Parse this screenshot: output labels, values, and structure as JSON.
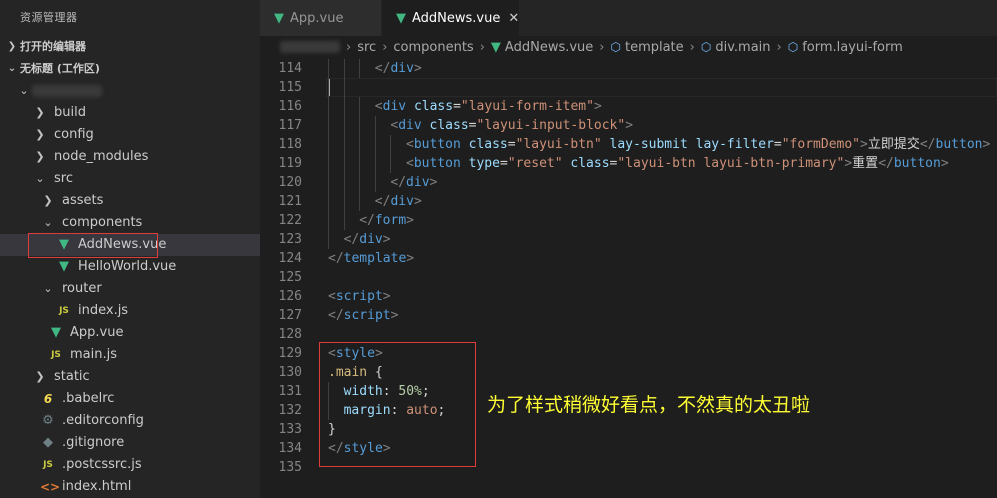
{
  "sidebar": {
    "title": "资源管理器",
    "open_editors": "打开的编辑器",
    "workspace": "无标题 (工作区)",
    "tree": [
      {
        "label": "build",
        "icon": "chevron-right",
        "indent": 1,
        "kind": "folder"
      },
      {
        "label": "config",
        "icon": "chevron-right",
        "indent": 1,
        "kind": "folder"
      },
      {
        "label": "node_modules",
        "icon": "chevron-right",
        "indent": 1,
        "kind": "folder"
      },
      {
        "label": "src",
        "icon": "chevron-down",
        "indent": 1,
        "kind": "folder"
      },
      {
        "label": "assets",
        "icon": "chevron-right",
        "indent": 2,
        "kind": "folder"
      },
      {
        "label": "components",
        "icon": "chevron-down",
        "indent": 2,
        "kind": "folder"
      },
      {
        "label": "AddNews.vue",
        "icon": "vue",
        "indent": 3,
        "kind": "file",
        "selected": true
      },
      {
        "label": "HelloWorld.vue",
        "icon": "vue",
        "indent": 3,
        "kind": "file"
      },
      {
        "label": "router",
        "icon": "chevron-down",
        "indent": 2,
        "kind": "folder"
      },
      {
        "label": "index.js",
        "icon": "js",
        "indent": 3,
        "kind": "file"
      },
      {
        "label": "App.vue",
        "icon": "vue",
        "indent": 2,
        "kind": "file"
      },
      {
        "label": "main.js",
        "icon": "js",
        "indent": 2,
        "kind": "file"
      },
      {
        "label": "static",
        "icon": "chevron-right",
        "indent": 1,
        "kind": "folder"
      },
      {
        "label": ".babelrc",
        "icon": "babel",
        "indent": 1,
        "kind": "file"
      },
      {
        "label": ".editorconfig",
        "icon": "gear",
        "indent": 1,
        "kind": "file"
      },
      {
        "label": ".gitignore",
        "icon": "git",
        "indent": 1,
        "kind": "file"
      },
      {
        "label": ".postcssrc.js",
        "icon": "js",
        "indent": 1,
        "kind": "file"
      },
      {
        "label": "index.html",
        "icon": "html",
        "indent": 1,
        "kind": "file"
      }
    ]
  },
  "tabs": [
    {
      "label": "App.vue",
      "active": false
    },
    {
      "label": "AddNews.vue",
      "active": true
    }
  ],
  "breadcrumb": [
    "src",
    "components",
    "AddNews.vue",
    "template",
    "div.main",
    "form.layui-form"
  ],
  "editor": {
    "current_line": 115,
    "lines": [
      {
        "n": "114",
        "i": 3,
        "c": [
          [
            "t",
            "</"
          ],
          [
            "tn",
            "div"
          ],
          [
            "t",
            ">"
          ]
        ]
      },
      {
        "n": "115",
        "i": 2,
        "c": []
      },
      {
        "n": "116",
        "i": 3,
        "c": [
          [
            "t",
            "<"
          ],
          [
            "tn",
            "div"
          ],
          [
            "tx",
            " "
          ],
          [
            "an",
            "class"
          ],
          [
            "tx",
            "="
          ],
          [
            "av",
            "\"layui-form-item\""
          ],
          [
            "t",
            ">"
          ]
        ]
      },
      {
        "n": "117",
        "i": 4,
        "c": [
          [
            "t",
            "<"
          ],
          [
            "tn",
            "div"
          ],
          [
            "tx",
            " "
          ],
          [
            "an",
            "class"
          ],
          [
            "tx",
            "="
          ],
          [
            "av",
            "\"layui-input-block\""
          ],
          [
            "t",
            ">"
          ]
        ]
      },
      {
        "n": "118",
        "i": 5,
        "c": [
          [
            "t",
            "<"
          ],
          [
            "tn",
            "button"
          ],
          [
            "tx",
            " "
          ],
          [
            "an",
            "class"
          ],
          [
            "tx",
            "="
          ],
          [
            "av",
            "\"layui-btn\""
          ],
          [
            "tx",
            " "
          ],
          [
            "an",
            "lay-submit"
          ],
          [
            "tx",
            " "
          ],
          [
            "an",
            "lay-filter"
          ],
          [
            "tx",
            "="
          ],
          [
            "av",
            "\"formDemo\""
          ],
          [
            "t",
            ">"
          ],
          [
            "tx",
            "立即提交"
          ],
          [
            "t",
            "</"
          ],
          [
            "tn",
            "button"
          ],
          [
            "t",
            ">"
          ]
        ]
      },
      {
        "n": "119",
        "i": 5,
        "c": [
          [
            "t",
            "<"
          ],
          [
            "tn",
            "button"
          ],
          [
            "tx",
            " "
          ],
          [
            "an",
            "type"
          ],
          [
            "tx",
            "="
          ],
          [
            "av",
            "\"reset\""
          ],
          [
            "tx",
            " "
          ],
          [
            "an",
            "class"
          ],
          [
            "tx",
            "="
          ],
          [
            "av",
            "\"layui-btn layui-btn-primary\""
          ],
          [
            "t",
            ">"
          ],
          [
            "tx",
            "重置"
          ],
          [
            "t",
            "</"
          ],
          [
            "tn",
            "button"
          ],
          [
            "t",
            ">"
          ]
        ]
      },
      {
        "n": "120",
        "i": 4,
        "c": [
          [
            "t",
            "</"
          ],
          [
            "tn",
            "div"
          ],
          [
            "t",
            ">"
          ]
        ]
      },
      {
        "n": "121",
        "i": 3,
        "c": [
          [
            "t",
            "</"
          ],
          [
            "tn",
            "div"
          ],
          [
            "t",
            ">"
          ]
        ]
      },
      {
        "n": "122",
        "i": 2,
        "c": [
          [
            "t",
            "</"
          ],
          [
            "tn",
            "form"
          ],
          [
            "t",
            ">"
          ]
        ]
      },
      {
        "n": "123",
        "i": 1,
        "c": [
          [
            "t",
            "</"
          ],
          [
            "tn",
            "div"
          ],
          [
            "t",
            ">"
          ]
        ]
      },
      {
        "n": "124",
        "i": 0,
        "c": [
          [
            "t",
            "</"
          ],
          [
            "tn",
            "template"
          ],
          [
            "t",
            ">"
          ]
        ]
      },
      {
        "n": "125",
        "i": 0,
        "c": []
      },
      {
        "n": "126",
        "i": 0,
        "c": [
          [
            "t",
            "<"
          ],
          [
            "tn",
            "script"
          ],
          [
            "t",
            ">"
          ]
        ]
      },
      {
        "n": "127",
        "i": 0,
        "c": [
          [
            "t",
            "</"
          ],
          [
            "tn",
            "script"
          ],
          [
            "t",
            ">"
          ]
        ]
      },
      {
        "n": "128",
        "i": 0,
        "c": []
      },
      {
        "n": "129",
        "i": 0,
        "c": [
          [
            "t",
            "<"
          ],
          [
            "tn",
            "style"
          ],
          [
            "t",
            ">"
          ]
        ]
      },
      {
        "n": "130",
        "i": 0,
        "c": [
          [
            "sel",
            ".main"
          ],
          [
            "tx",
            " {"
          ]
        ]
      },
      {
        "n": "131",
        "i": 1,
        "c": [
          [
            "an",
            "width"
          ],
          [
            "tx",
            ": "
          ],
          [
            "num",
            "50%"
          ],
          [
            "tx",
            ";"
          ]
        ]
      },
      {
        "n": "132",
        "i": 1,
        "c": [
          [
            "an",
            "margin"
          ],
          [
            "tx",
            ": "
          ],
          [
            "av",
            "auto"
          ],
          [
            "tx",
            ";"
          ]
        ]
      },
      {
        "n": "133",
        "i": 0,
        "c": [
          [
            "tx",
            "}"
          ]
        ]
      },
      {
        "n": "134",
        "i": 0,
        "c": [
          [
            "t",
            "</"
          ],
          [
            "tn",
            "style"
          ],
          [
            "t",
            ">"
          ]
        ]
      },
      {
        "n": "135",
        "i": 0,
        "c": []
      }
    ]
  },
  "annotation": "为了样式稍微好看点，不然真的太丑啦",
  "colors": {
    "vue": "#41b883",
    "highlight_box": "#e03c3c",
    "annotation": "#ffff33"
  }
}
